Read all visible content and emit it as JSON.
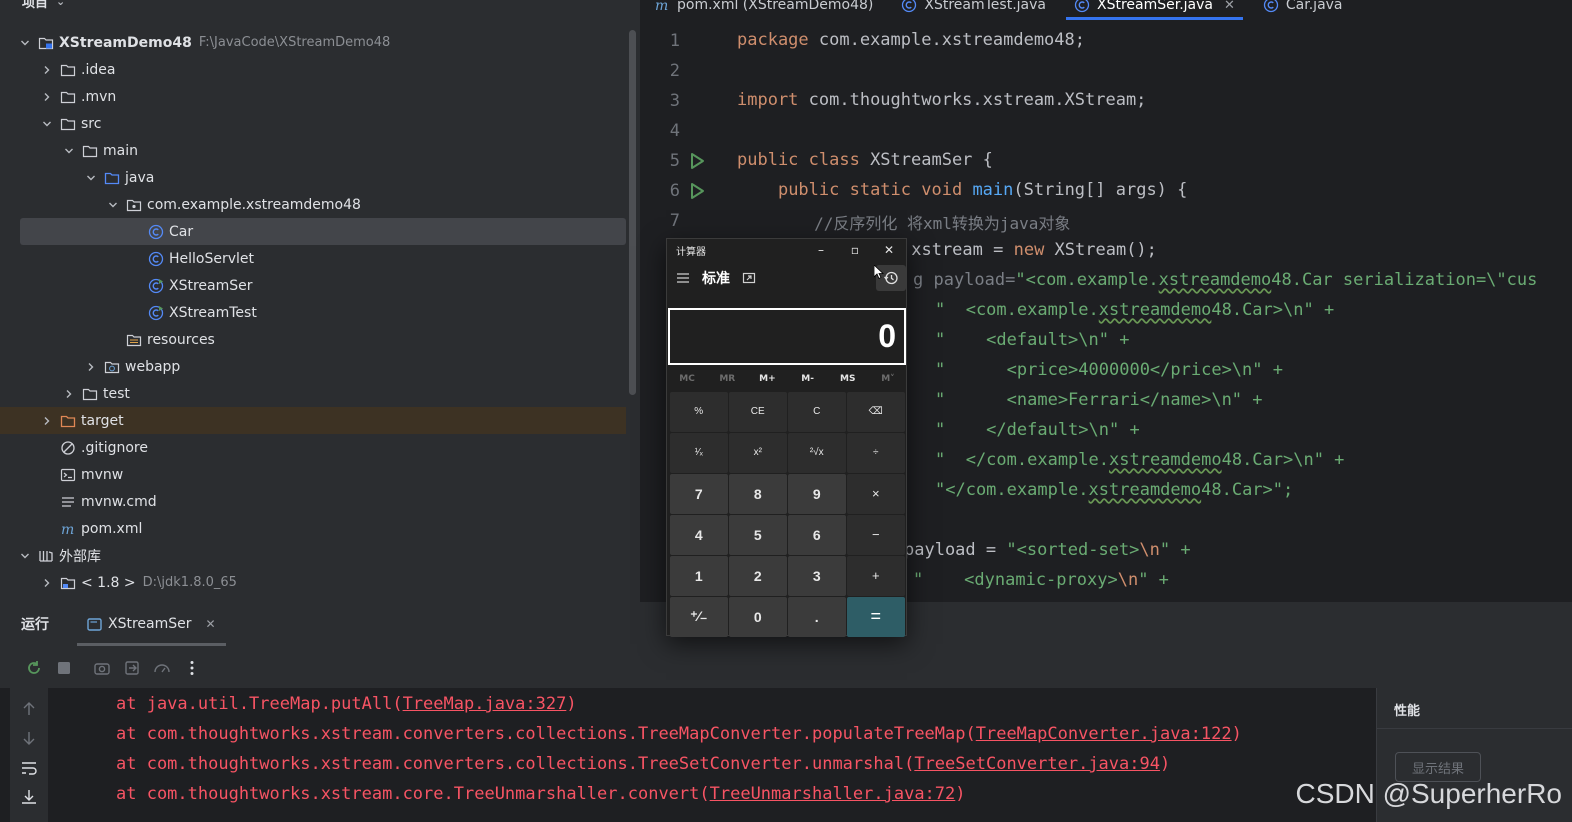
{
  "project": {
    "header": "项目",
    "tree": [
      {
        "label": "XStreamDemo48",
        "path": "F:\\JavaCode\\XStreamDemo48",
        "icon": "module-folder-icon",
        "depth": 0,
        "chevron": "down",
        "bold": true
      },
      {
        "label": ".idea",
        "icon": "folder-icon",
        "depth": 1,
        "chevron": "right"
      },
      {
        "label": ".mvn",
        "icon": "folder-icon",
        "depth": 1,
        "chevron": "right"
      },
      {
        "label": "src",
        "icon": "folder-icon",
        "depth": 1,
        "chevron": "down"
      },
      {
        "label": "main",
        "icon": "folder-icon",
        "depth": 2,
        "chevron": "down"
      },
      {
        "label": "java",
        "icon": "source-folder-icon",
        "depth": 3,
        "chevron": "down"
      },
      {
        "label": "com.example.xstreamdemo48",
        "icon": "package-icon",
        "depth": 4,
        "chevron": "down"
      },
      {
        "label": "Car",
        "icon": "java-class-icon",
        "depth": 5,
        "chevron": "",
        "selected": true
      },
      {
        "label": "HelloServlet",
        "icon": "java-class-icon",
        "depth": 5,
        "chevron": ""
      },
      {
        "label": "XStreamSer",
        "icon": "runnable-class-icon",
        "depth": 5,
        "chevron": ""
      },
      {
        "label": "XStreamTest",
        "icon": "runnable-class-icon",
        "depth": 5,
        "chevron": ""
      },
      {
        "label": "resources",
        "icon": "resources-folder-icon",
        "depth": 4,
        "chevron": ""
      },
      {
        "label": "webapp",
        "icon": "web-folder-icon",
        "depth": 3,
        "chevron": "right"
      },
      {
        "label": "test",
        "icon": "folder-icon",
        "depth": 2,
        "chevron": "right"
      },
      {
        "label": "target",
        "icon": "excluded-folder-icon",
        "depth": 1,
        "chevron": "right",
        "target": true
      },
      {
        "label": ".gitignore",
        "icon": "gitignore-icon",
        "depth": 1,
        "chevron": ""
      },
      {
        "label": "mvnw",
        "icon": "terminal-file-icon",
        "depth": 1,
        "chevron": ""
      },
      {
        "label": "mvnw.cmd",
        "icon": "text-file-icon",
        "depth": 1,
        "chevron": ""
      },
      {
        "label": "pom.xml",
        "icon": "maven-file-icon",
        "depth": 1,
        "chevron": ""
      },
      {
        "label": "外部库",
        "icon": "library-icon",
        "depth": 0,
        "chevron": "down"
      },
      {
        "label": "< 1.8 >",
        "path": "D:\\jdk1.8.0_65",
        "icon": "jdk-icon",
        "depth": 1,
        "chevron": "right"
      }
    ]
  },
  "editor": {
    "tabs": [
      {
        "label": "pom.xml (XStreamDemo48)",
        "icon": "maven-file-icon"
      },
      {
        "label": "XStreamTest.java",
        "icon": "java-class-icon"
      },
      {
        "label": "XStreamSer.java",
        "icon": "java-class-icon",
        "active": true,
        "close": "✕"
      },
      {
        "label": "Car.java",
        "icon": "java-class-icon"
      }
    ],
    "line_numbers": [
      "1",
      "2",
      "3",
      "4",
      "5",
      "6",
      "7"
    ],
    "code": {
      "l1_kw": "package",
      "l1_rest": " com.example.xstreamdemo48;",
      "l3_kw": "import",
      "l3_rest": " com.thoughtworks.xstream.XStream;",
      "l5_kw": "public class",
      "l5_rest": " XStreamSer {",
      "l6_indent": "    ",
      "l6_kw": "public static void",
      "l6_sp": " ",
      "l6_fn": "main",
      "l6_rest": "(String[] args) {",
      "l7": "        //反序列化 将xml转换为java对象",
      "l8_rest": " xstream = ",
      "l8_kw": "new",
      "l8_end": " XStream();",
      "l9_a": "g payload=",
      "l9_str": "\"<com.example.",
      "l9_wavy": "xstreamdemo",
      "l9_str2": "48.Car serialization=\\\"cus",
      "l10_q": "\"  <com.example.",
      "l10_wavy": "xstreamdemo",
      "l10_end": "48.Car>\\n\" +",
      "l11": "\"    <default>\\n\" +",
      "l12": "\"      <price>4000000</price>\\n\" +",
      "l13": "\"      <name>Ferrari</name>\\n\" +",
      "l14": "\"    </default>\\n\" +",
      "l15_q": "\"  </com.example.",
      "l15_wavy": "xstreamdemo",
      "l15_end": "48.Car>\\n\" +",
      "l16_q": "\"</com.example.",
      "l16_wavy": "xstreamdemo",
      "l16_end": "48.Car>\";",
      "l18_a": "payload = ",
      "l18_str": "\"<sorted-set>",
      "l18_esc": "\\n",
      "l18_end": "\" +",
      "l19_q": "\"    <dynamic-proxy>",
      "l19_esc": "\\n",
      "l19_end": "\" +"
    }
  },
  "run": {
    "title": "运行",
    "tab_label": "XStreamSer",
    "tab_close": "✕",
    "trace": [
      {
        "prefix": "at java.util.TreeMap.putAll(",
        "link": "TreeMap.java:327",
        "suffix": ")"
      },
      {
        "prefix": "at com.thoughtworks.xstream.converters.collections.TreeMapConverter.populateTreeMap(",
        "link": "TreeMapConverter.java:122",
        "suffix": ")"
      },
      {
        "prefix": "at com.thoughtworks.xstream.converters.collections.TreeSetConverter.unmarshal(",
        "link": "TreeSetConverter.java:94",
        "suffix": ")"
      },
      {
        "prefix": "at com.thoughtworks.xstream.core.TreeUnmarshaller.convert(",
        "link": "TreeUnmarshaller.java:72",
        "suffix": ")"
      }
    ],
    "perf_title": "性能",
    "perf_button": "显示结果"
  },
  "calculator": {
    "title": "计算器",
    "mode": "标准",
    "display": "0",
    "minimize": "–",
    "maximize": "▫",
    "close": "✕",
    "memory": [
      "MC",
      "MR",
      "M+",
      "M-",
      "MS",
      "M˅"
    ],
    "keys": [
      {
        "label": "%",
        "type": "op"
      },
      {
        "label": "CE",
        "type": "op"
      },
      {
        "label": "C",
        "type": "op"
      },
      {
        "label": "⌫",
        "type": "op"
      },
      {
        "label": "¹⁄ₓ",
        "type": "op"
      },
      {
        "label": "x²",
        "type": "op"
      },
      {
        "label": "²√x",
        "type": "op"
      },
      {
        "label": "÷",
        "type": "op"
      },
      {
        "label": "7",
        "type": "num"
      },
      {
        "label": "8",
        "type": "num"
      },
      {
        "label": "9",
        "type": "num"
      },
      {
        "label": "×",
        "type": "op"
      },
      {
        "label": "4",
        "type": "num"
      },
      {
        "label": "5",
        "type": "num"
      },
      {
        "label": "6",
        "type": "num"
      },
      {
        "label": "−",
        "type": "op"
      },
      {
        "label": "1",
        "type": "num"
      },
      {
        "label": "2",
        "type": "num"
      },
      {
        "label": "3",
        "type": "num"
      },
      {
        "label": "+",
        "type": "op"
      },
      {
        "label": "⁺⁄₋",
        "type": "num"
      },
      {
        "label": "0",
        "type": "num"
      },
      {
        "label": ".",
        "type": "num"
      },
      {
        "label": "=",
        "type": "eq"
      }
    ]
  },
  "watermark": "CSDN @SuperherRo",
  "colors": {
    "keyword": "#cf8e6d",
    "string": "#6aab73",
    "comment": "#7a7e85",
    "error_trace": "#f75464",
    "accent": "#3574f0",
    "equals_key": "#2e5d66"
  }
}
